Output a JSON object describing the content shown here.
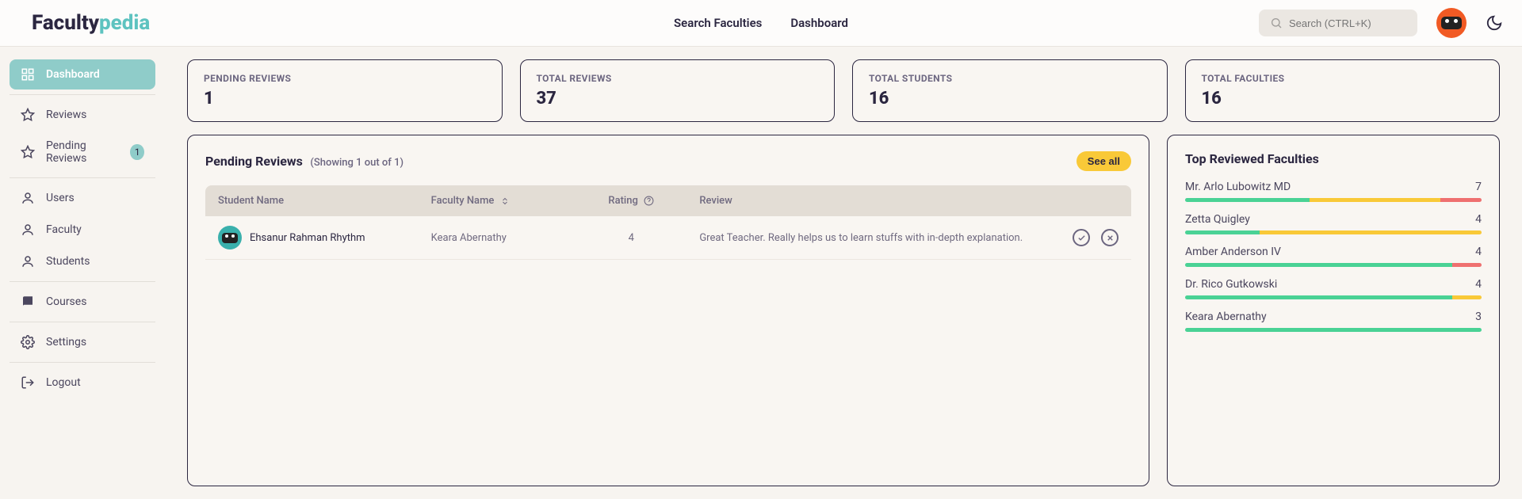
{
  "logo": {
    "part1": "Faculty",
    "part2": "pedia"
  },
  "nav": {
    "search": "Search Faculties",
    "dashboard": "Dashboard"
  },
  "search": {
    "placeholder": "Search (CTRL+K)"
  },
  "sidebar": {
    "items": [
      {
        "label": "Dashboard"
      },
      {
        "label": "Reviews"
      },
      {
        "label": "Pending Reviews",
        "badge": "1"
      },
      {
        "label": "Users"
      },
      {
        "label": "Faculty"
      },
      {
        "label": "Students"
      },
      {
        "label": "Courses"
      },
      {
        "label": "Settings"
      },
      {
        "label": "Logout"
      }
    ]
  },
  "stats": [
    {
      "label": "PENDING REVIEWS",
      "value": "1"
    },
    {
      "label": "TOTAL REVIEWS",
      "value": "37"
    },
    {
      "label": "TOTAL STUDENTS",
      "value": "16"
    },
    {
      "label": "TOTAL FACULTIES",
      "value": "16"
    }
  ],
  "pending": {
    "title": "Pending Reviews",
    "subtitle": "(Showing 1 out of 1)",
    "see_all": "See all",
    "columns": {
      "student": "Student Name",
      "faculty": "Faculty Name",
      "rating": "Rating",
      "review": "Review"
    },
    "rows": [
      {
        "student": "Ehsanur Rahman Rhythm",
        "faculty": "Keara Abernathy",
        "rating": "4",
        "review": "Great Teacher. Really helps us to learn stuffs with in-depth explanation."
      }
    ]
  },
  "top": {
    "title": "Top Reviewed Faculties",
    "items": [
      {
        "name": "Mr. Arlo Lubowitz MD",
        "count": "7",
        "g": 42,
        "y": 44,
        "r": 14
      },
      {
        "name": "Zetta Quigley",
        "count": "4",
        "g": 25,
        "y": 75,
        "r": 0
      },
      {
        "name": "Amber Anderson IV",
        "count": "4",
        "g": 90,
        "y": 0,
        "r": 10
      },
      {
        "name": "Dr. Rico Gutkowski",
        "count": "4",
        "g": 90,
        "y": 10,
        "r": 0
      },
      {
        "name": "Keara Abernathy",
        "count": "3",
        "g": 100,
        "y": 0,
        "r": 0
      }
    ]
  }
}
